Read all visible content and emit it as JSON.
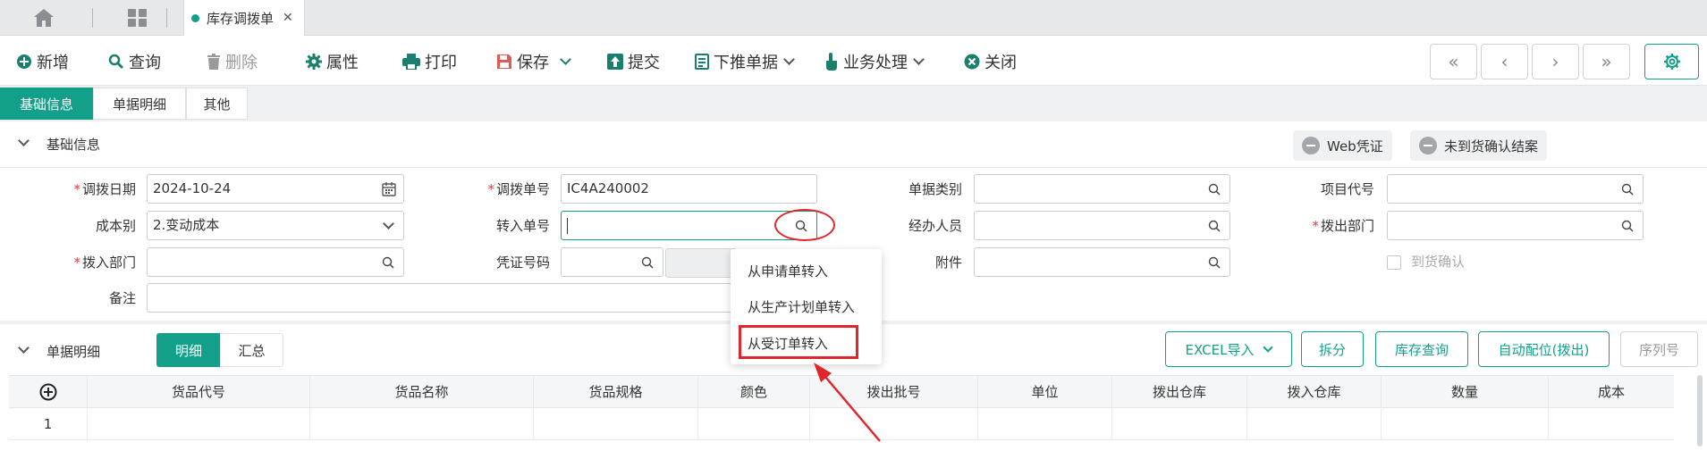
{
  "topbar": {
    "icons": [
      "home-icon",
      "grid-icon"
    ],
    "tab_label": "库存调拨单",
    "tab_close": "✕"
  },
  "toolbar": {
    "new": "新增",
    "query": "查询",
    "delete": "删除",
    "properties": "属性",
    "print": "打印",
    "save": "保存",
    "submit": "提交",
    "push_down": "下推单据",
    "business": "业务处理",
    "close": "关闭",
    "nav": [
      "«",
      "‹",
      "›",
      "»"
    ]
  },
  "subtabs": [
    "基础信息",
    "单据明细",
    "其他"
  ],
  "basic_section": {
    "title": "基础信息",
    "web_voucher": "Web凭证",
    "not_arrived_close": "未到货确认结案"
  },
  "form": {
    "transfer_date_label": "调拨日期",
    "transfer_date_value": "2024-10-24",
    "transfer_no_label": "调拨单号",
    "transfer_no_value": "IC4A240002",
    "doc_type_label": "单据类别",
    "project_code_label": "项目代号",
    "cost_type_label": "成本别",
    "cost_type_value": "2.变动成本",
    "transfer_in_no_label": "转入单号",
    "handler_label": "经办人员",
    "out_dept_label": "拨出部门",
    "in_dept_label": "拨入部门",
    "voucher_no_label": "凭证号码",
    "attachment_label": "附件",
    "arrival_confirm_label": "到货确认",
    "remark_label": "备注"
  },
  "dropdown_menu": {
    "items": [
      "从申请单转入",
      "从生产计划单转入",
      "从受订单转入"
    ],
    "highlighted": "从受订单转入"
  },
  "detail_section": {
    "title": "单据明细",
    "seg_detail": "明细",
    "seg_summary": "汇总",
    "excel_import": "EXCEL导入",
    "split": "拆分",
    "stock_query": "库存查询",
    "auto_allocate": "自动配位(拨出)",
    "serial_no": "序列号"
  },
  "table": {
    "columns": [
      "货品代号",
      "货品名称",
      "货品规格",
      "颜色",
      "拨出批号",
      "单位",
      "拨出仓库",
      "拨入仓库",
      "数量",
      "成本"
    ],
    "rows": [
      {
        "index": "1"
      }
    ]
  },
  "colors": {
    "accent": "#13a08a",
    "annotation_red": "#e0262a",
    "required_star": "#e23b3b"
  }
}
